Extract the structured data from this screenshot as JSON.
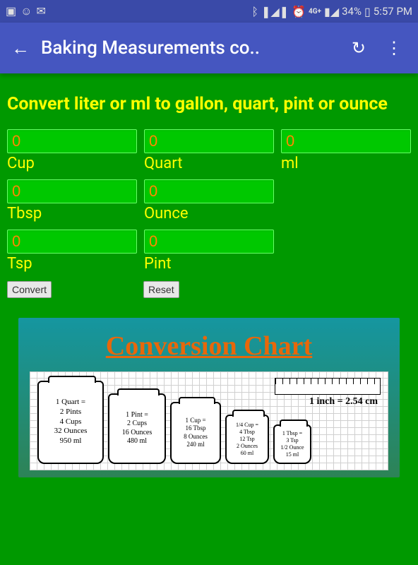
{
  "status": {
    "battery": "34%",
    "time": "5:57 PM",
    "net_label": "4G+"
  },
  "appbar": {
    "title": "Baking Measurements co.."
  },
  "heading": "Convert liter or ml to gallon, quart, pint or ounce",
  "fields": {
    "cup": {
      "value": "0",
      "label": "Cup"
    },
    "tbsp": {
      "value": "0",
      "label": "Tbsp"
    },
    "tsp": {
      "value": "0",
      "label": "Tsp"
    },
    "quart": {
      "value": "0",
      "label": "Quart"
    },
    "ounce": {
      "value": "0",
      "label": "Ounce"
    },
    "pint": {
      "value": "0",
      "label": "Pint"
    },
    "ml": {
      "value": "0",
      "label": "ml"
    }
  },
  "buttons": {
    "convert": "Convert",
    "reset": "Reset"
  },
  "chart": {
    "title": "Conversion Chart",
    "ruler_label": "1 inch = 2.54 cm",
    "jars": [
      {
        "lines": [
          "1 Quart =",
          "2 Pints",
          "4 Cups",
          "32 Ounces",
          "950 ml"
        ]
      },
      {
        "lines": [
          "1 Pint =",
          "2 Cups",
          "16 Ounces",
          "480 ml"
        ]
      },
      {
        "lines": [
          "1 Cup =",
          "16 Tbsp",
          "8 Ounces",
          "240 ml"
        ]
      },
      {
        "lines": [
          "1/4 Cup =",
          "4 Tbsp",
          "12 Tsp",
          "2 Ounces",
          "60 ml"
        ]
      },
      {
        "lines": [
          "1 Tbsp =",
          "3 Tsp",
          "1/2 Ounce",
          "15 ml"
        ]
      }
    ]
  }
}
